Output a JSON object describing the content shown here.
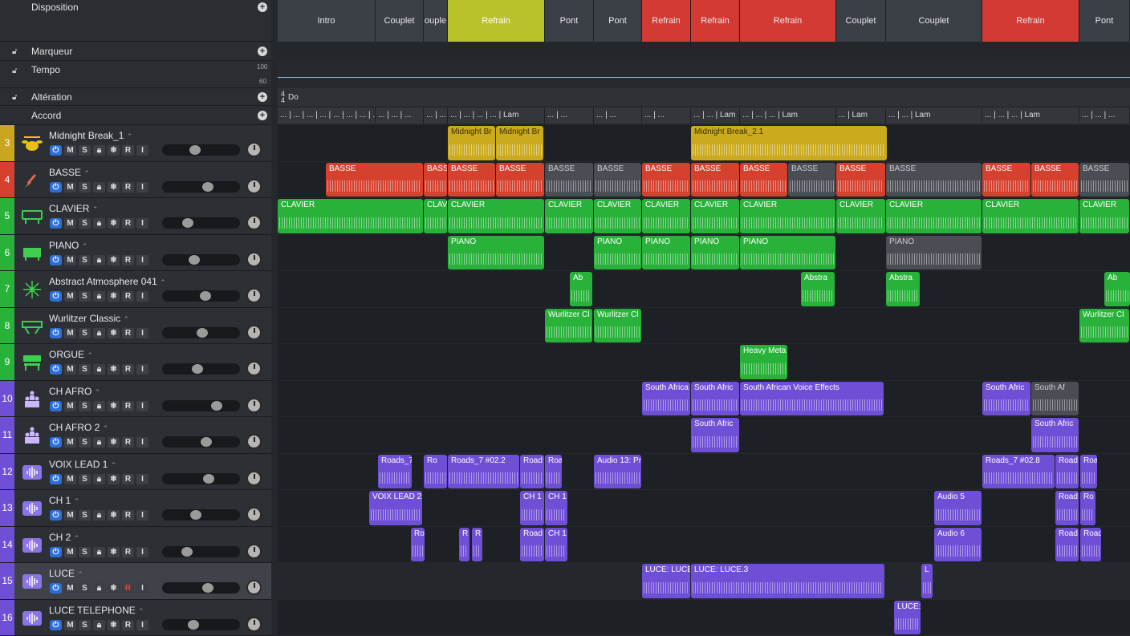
{
  "global_tracks": {
    "arrangement": "Disposition",
    "marker": "Marqueur",
    "tempo": "Tempo",
    "tempo_hi": "100",
    "tempo_lo": "60",
    "signature": "Altération",
    "chord": "Accord",
    "sig_top": "4",
    "sig_bottom": "4",
    "key": "Do"
  },
  "sections": [
    {
      "label": "Intro",
      "color": "#3b3f46"
    },
    {
      "label": "Couplet",
      "color": "#3b3f46"
    },
    {
      "label": "ouple",
      "color": "#3b3f46"
    },
    {
      "label": "Refrain",
      "color": "#b9c22a"
    },
    {
      "label": "Pont",
      "color": "#3b3f46"
    },
    {
      "label": "Pont",
      "color": "#3b3f46"
    },
    {
      "label": "Refrain",
      "color": "#d33a34"
    },
    {
      "label": "Refrain",
      "color": "#d33a34"
    },
    {
      "label": "Refrain",
      "color": "#d33a34"
    },
    {
      "label": "Couplet",
      "color": "#3b3f46"
    },
    {
      "label": "Couplet",
      "color": "#3b3f46"
    },
    {
      "label": "Refrain",
      "color": "#d33a34"
    },
    {
      "label": "Pont",
      "color": "#3b3f46"
    }
  ],
  "chords": [
    "... | ... | ... | ... | ... | ... | ... | ... | Lam",
    "... | ... | ...",
    "... | ...",
    "... | ... | ... | ... | Lam",
    "... | ...",
    "... | ...",
    "... | ...",
    "... | ... | Lam",
    "... | ... | ... | Lam",
    "... | Lam",
    "... | ... | Lam",
    "... | ... | ... | Lam",
    "... | ... | ..."
  ],
  "tracks": [
    {
      "num": "3",
      "name": "Midnight Break_1",
      "color": "#c9a520",
      "icon": "drum-kit-icon"
    },
    {
      "num": "4",
      "name": "BASSE",
      "color": "#d5412e",
      "icon": "bass-guitar-icon"
    },
    {
      "num": "5",
      "name": "CLAVIER",
      "color": "#28b23a",
      "icon": "keyboard-icon"
    },
    {
      "num": "6",
      "name": "PIANO",
      "color": "#28b23a",
      "icon": "piano-icon"
    },
    {
      "num": "7",
      "name": "Abstract Atmosphere 041",
      "color": "#28b23a",
      "icon": "synth-burst-icon"
    },
    {
      "num": "8",
      "name": "Wurlitzer Classic",
      "color": "#28b23a",
      "icon": "electric-piano-icon"
    },
    {
      "num": "9",
      "name": "ORGUE",
      "color": "#28b23a",
      "icon": "organ-icon"
    },
    {
      "num": "10",
      "name": "CH AFRO",
      "color": "#6f4fd6",
      "icon": "choir-icon"
    },
    {
      "num": "11",
      "name": "CH AFRO 2",
      "color": "#6f4fd6",
      "icon": "choir-icon"
    },
    {
      "num": "12",
      "name": "VOIX LEAD 1",
      "color": "#6f4fd6",
      "icon": "waveform-icon"
    },
    {
      "num": "13",
      "name": "CH 1",
      "color": "#6f4fd6",
      "icon": "waveform-icon"
    },
    {
      "num": "14",
      "name": "CH 2",
      "color": "#6f4fd6",
      "icon": "waveform-icon"
    },
    {
      "num": "15",
      "name": "LUCE",
      "color": "#6f4fd6",
      "icon": "waveform-icon"
    },
    {
      "num": "16",
      "name": "LUCE TELEPHONE",
      "color": "#6f4fd6",
      "icon": "waveform-icon"
    }
  ],
  "buttons": {
    "mute": "M",
    "solo": "S",
    "freeze": "❄",
    "record": "R",
    "input": "I"
  },
  "regions": {
    "r3": [
      "Midnight Br",
      "Midnight Br",
      "Midnight Break_2.1"
    ],
    "r4": [
      "BASSE",
      "BASS",
      "BASSE",
      "BASSE",
      "BASSE",
      "BASSE",
      "BASSE",
      "BASSE",
      "BASSE",
      "BASSE",
      "BASSE",
      "BASSE",
      "BASSE",
      "BASSE",
      "BASSE"
    ],
    "r5": [
      "CLAVIER",
      "CLAV",
      "CLAVIER",
      "CLAVIER",
      "CLAVIER",
      "CLAVIER",
      "CLAVIER",
      "CLAVIER",
      "CLAVIER",
      "CLAVIER",
      "CLAVIER",
      "CLAVIER"
    ],
    "r6": [
      "PIANO",
      "PIANO",
      "PIANO",
      "PIANO",
      "PIANO",
      "PIANO"
    ],
    "r7": [
      "Ab",
      "Abstra",
      "Abstra",
      "Ab"
    ],
    "r8": [
      "Wurlitzer Cl",
      "Wurlitzer Cl",
      "Wurlitzer Cl"
    ],
    "r9": [
      "Heavy Meta"
    ],
    "r10": [
      "South Africa",
      "South Afric",
      "South African Voice Effects",
      "South Afric",
      "South Af"
    ],
    "r11": [
      "South Afric",
      "South Afric"
    ],
    "r12": [
      "Roads_7",
      "Ro",
      "Roads_7 #02.2",
      "Road",
      "Roa",
      "Audio 13: Pri",
      "Roads_7 #02.8",
      "Road",
      "Roa"
    ],
    "r13": [
      "VOIX LEAD 2",
      "CH 1",
      "CH 1",
      "Audio 5",
      "Road",
      "Ro"
    ],
    "r14": [
      "Ro",
      "R",
      "R",
      "Road",
      "CH 1",
      "Audio 6",
      "Road",
      "Road"
    ],
    "r15": [
      "LUCE: LUCE",
      "LUCE: LUCE.3",
      "L"
    ],
    "r16": [
      "LUCE:"
    ]
  }
}
